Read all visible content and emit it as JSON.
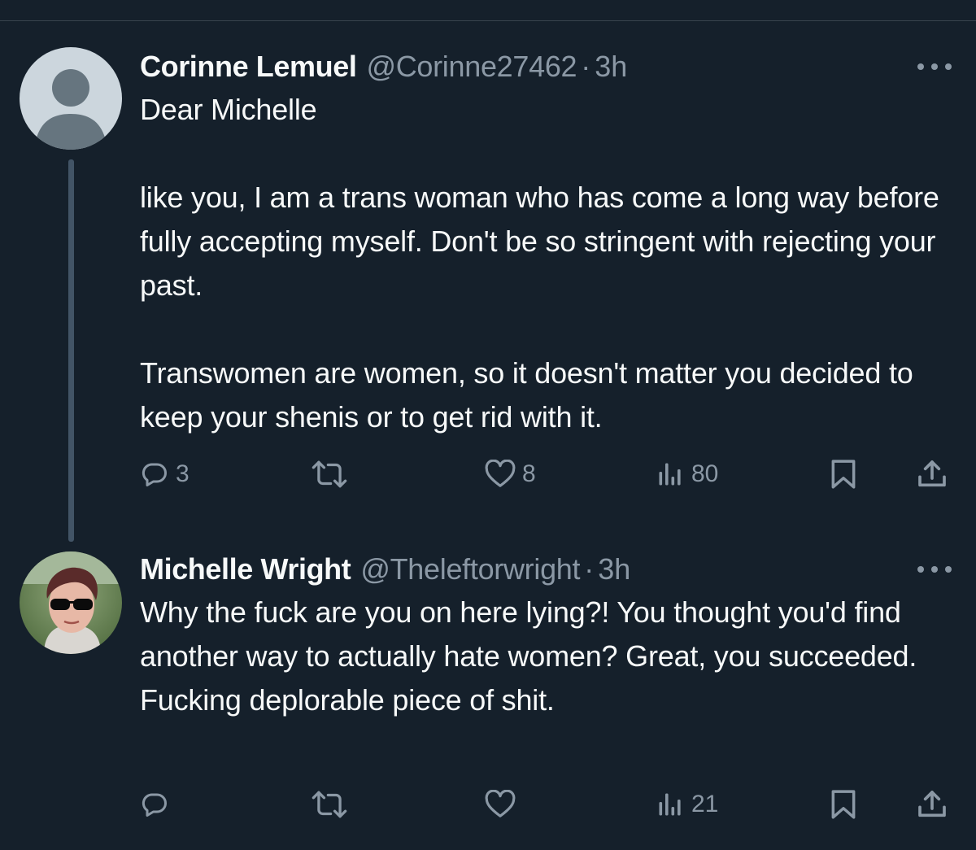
{
  "tweets": [
    {
      "author": {
        "name": "Corinne Lemuel",
        "handle": "@Corinne27462",
        "separator": "·",
        "time": "3h",
        "avatar": "default-avatar-icon"
      },
      "text": "Dear Michelle\n\nlike you, I am a trans woman who has come a long way before fully accepting myself. Don't be so stringent with rejecting your past.\n\nTranswomen are women, so it doesn't matter you decided to keep your shenis or to get rid with it.",
      "actions": {
        "replies": "3",
        "retweets": "",
        "likes": "8",
        "views": "80"
      }
    },
    {
      "author": {
        "name": "Michelle Wright",
        "handle": "@Theleftorwright",
        "separator": "·",
        "time": "3h",
        "avatar": "profile-photo"
      },
      "text": "Why the fuck are you on here lying?! You thought you'd find another way to actually hate women? Great, you succeeded. Fucking deplorable piece of shit.",
      "actions": {
        "replies": "",
        "retweets": "",
        "likes": "",
        "views": "21"
      }
    }
  ],
  "colors": {
    "background": "#15202b",
    "text_primary": "#f7f9f9",
    "text_secondary": "#8b98a5",
    "thread_line": "#425466"
  }
}
